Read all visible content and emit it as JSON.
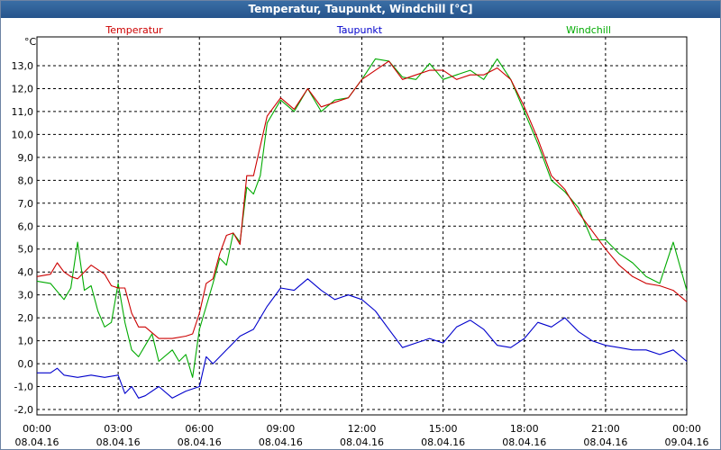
{
  "window": {
    "title": "Temperatur, Taupunkt, Windchill [°C]"
  },
  "chart_data": {
    "type": "line",
    "title": "Temperatur, Taupunkt, Windchill [°C]",
    "ylabel": "°C",
    "ylim": [
      -2.0,
      14.0
    ],
    "y_ticks": [
      "-2,0",
      "-1,0",
      "0,0",
      "1,0",
      "2,0",
      "3,0",
      "4,0",
      "5,0",
      "6,0",
      "7,0",
      "8,0",
      "9,0",
      "10,0",
      "11,0",
      "12,0",
      "13,0"
    ],
    "x_ticks": [
      {
        "time": "00:00",
        "date": "08.04.16"
      },
      {
        "time": "03:00",
        "date": "08.04.16"
      },
      {
        "time": "06:00",
        "date": "08.04.16"
      },
      {
        "time": "09:00",
        "date": "08.04.16"
      },
      {
        "time": "12:00",
        "date": "08.04.16"
      },
      {
        "time": "15:00",
        "date": "08.04.16"
      },
      {
        "time": "18:00",
        "date": "08.04.16"
      },
      {
        "time": "21:00",
        "date": "08.04.16"
      },
      {
        "time": "00:00",
        "date": "09.04.16"
      }
    ],
    "xlim_hours": [
      0,
      24
    ],
    "grid": true,
    "legend_placement": "top",
    "series": [
      {
        "name": "Temperatur",
        "color": "#cc0000",
        "hours": [
          0,
          0.5,
          0.75,
          1,
          1.25,
          1.5,
          2,
          2.5,
          2.75,
          3,
          3.25,
          3.5,
          3.75,
          4,
          4.5,
          5,
          5.5,
          5.75,
          6,
          6.25,
          6.5,
          6.75,
          7,
          7.25,
          7.5,
          7.75,
          8,
          8.5,
          9,
          9.5,
          10,
          10.5,
          11,
          11.5,
          12,
          12.5,
          13,
          13.5,
          14,
          14.5,
          15,
          15.5,
          16,
          16.5,
          17,
          17.5,
          18,
          18.5,
          19,
          19.5,
          20,
          20.5,
          21,
          21.5,
          22,
          22.5,
          23,
          23.5,
          24
        ],
        "values": [
          3.8,
          3.9,
          4.4,
          4.0,
          3.8,
          3.7,
          4.3,
          3.9,
          3.4,
          3.3,
          3.3,
          2.2,
          1.6,
          1.6,
          1.1,
          1.1,
          1.2,
          1.3,
          2.2,
          3.5,
          3.7,
          4.8,
          5.6,
          5.7,
          5.2,
          8.2,
          8.2,
          10.8,
          11.6,
          11.1,
          12.0,
          11.2,
          11.4,
          11.6,
          12.4,
          12.8,
          13.2,
          12.4,
          12.6,
          12.8,
          12.8,
          12.4,
          12.6,
          12.6,
          12.9,
          12.4,
          11.2,
          9.8,
          8.2,
          7.6,
          6.6,
          5.8,
          5.0,
          4.3,
          3.8,
          3.5,
          3.4,
          3.2,
          2.7
        ]
      },
      {
        "name": "Taupunkt",
        "color": "#0000cc",
        "hours": [
          0,
          0.5,
          0.75,
          1,
          1.5,
          2,
          2.5,
          3,
          3.25,
          3.5,
          3.75,
          4,
          4.5,
          5,
          5.5,
          6,
          6.25,
          6.5,
          7,
          7.5,
          8,
          8.5,
          9,
          9.5,
          10,
          10.5,
          11,
          11.5,
          12,
          12.5,
          13,
          13.5,
          14,
          14.5,
          15,
          15.5,
          16,
          16.5,
          17,
          17.5,
          18,
          18.5,
          19,
          19.5,
          20,
          20.5,
          21,
          21.5,
          22,
          22.5,
          23,
          23.5,
          24
        ],
        "values": [
          -0.4,
          -0.4,
          -0.2,
          -0.5,
          -0.6,
          -0.5,
          -0.6,
          -0.5,
          -1.3,
          -1.0,
          -1.5,
          -1.4,
          -1.0,
          -1.5,
          -1.2,
          -1.0,
          0.3,
          0.0,
          0.6,
          1.2,
          1.5,
          2.5,
          3.3,
          3.2,
          3.7,
          3.2,
          2.8,
          3.0,
          2.8,
          2.3,
          1.5,
          0.7,
          0.9,
          1.1,
          0.9,
          1.6,
          1.9,
          1.5,
          0.8,
          0.7,
          1.1,
          1.8,
          1.6,
          2.0,
          1.4,
          1.0,
          0.8,
          0.7,
          0.6,
          0.6,
          0.4,
          0.6,
          0.1
        ]
      },
      {
        "name": "Windchill",
        "color": "#00aa00",
        "hours": [
          0,
          0.5,
          1,
          1.25,
          1.5,
          1.75,
          2,
          2.25,
          2.5,
          2.75,
          3,
          3.25,
          3.5,
          3.75,
          4,
          4.25,
          4.5,
          5,
          5.25,
          5.5,
          5.75,
          6,
          6.25,
          6.5,
          6.75,
          7,
          7.25,
          7.5,
          7.75,
          8,
          8.25,
          8.5,
          9,
          9.5,
          10,
          10.5,
          11,
          11.5,
          12,
          12.5,
          13,
          13.5,
          14,
          14.5,
          15,
          15.5,
          16,
          16.5,
          17,
          17.5,
          18,
          18.5,
          19,
          19.5,
          20,
          20.5,
          21,
          21.5,
          22,
          22.5,
          23,
          23.5,
          24
        ],
        "values": [
          3.6,
          3.5,
          2.8,
          3.3,
          5.3,
          3.2,
          3.4,
          2.3,
          1.6,
          1.8,
          3.5,
          1.8,
          0.6,
          0.3,
          0.8,
          1.3,
          0.1,
          0.6,
          0.1,
          0.4,
          -0.6,
          1.5,
          2.5,
          3.5,
          4.6,
          4.3,
          5.7,
          5.3,
          7.7,
          7.4,
          8.2,
          10.5,
          11.5,
          11.0,
          12.0,
          11.0,
          11.5,
          11.6,
          12.4,
          13.3,
          13.2,
          12.5,
          12.4,
          13.1,
          12.4,
          12.6,
          12.8,
          12.4,
          13.3,
          12.4,
          11.0,
          9.6,
          8.0,
          7.5,
          6.8,
          5.4,
          5.4,
          4.8,
          4.4,
          3.8,
          3.5,
          5.3,
          3.2
        ]
      }
    ]
  }
}
